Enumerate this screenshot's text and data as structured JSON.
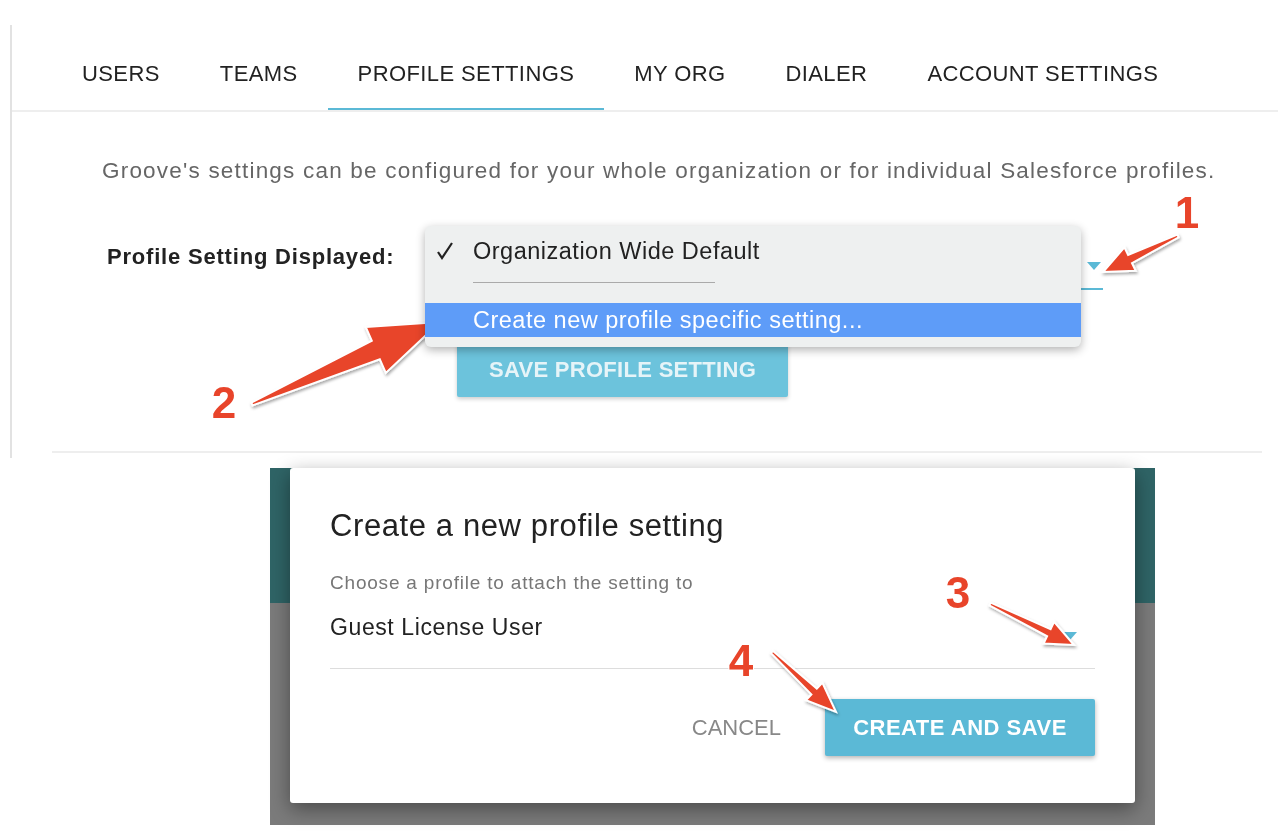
{
  "tabs": [
    {
      "label": "USERS",
      "selected": false
    },
    {
      "label": "TEAMS",
      "selected": false
    },
    {
      "label": "PROFILE SETTINGS",
      "selected": true
    },
    {
      "label": "MY ORG",
      "selected": false
    },
    {
      "label": "DIALER",
      "selected": false
    },
    {
      "label": "ACCOUNT SETTINGS",
      "selected": false
    }
  ],
  "description": "Groove's settings can be configured for your whole organization or for individual Salesforce profiles.",
  "profile_select": {
    "label": "Profile Setting Displayed:",
    "menu": [
      {
        "kind": "option",
        "label": "Organization Wide Default",
        "checked": true,
        "highlighted": false
      },
      {
        "kind": "separator"
      },
      {
        "kind": "option",
        "label": "Create new profile specific setting...",
        "checked": false,
        "highlighted": true
      }
    ]
  },
  "save_button": "SAVE PROFILE SETTING",
  "dialog": {
    "title": "Create a new profile setting",
    "field_label": "Choose a profile to attach the setting to",
    "value": "Guest License User",
    "cancel": "CANCEL",
    "confirm": "CREATE AND SAVE"
  },
  "annotations": [
    {
      "label": "1"
    },
    {
      "label": "2"
    },
    {
      "label": "3"
    },
    {
      "label": "4"
    }
  ]
}
